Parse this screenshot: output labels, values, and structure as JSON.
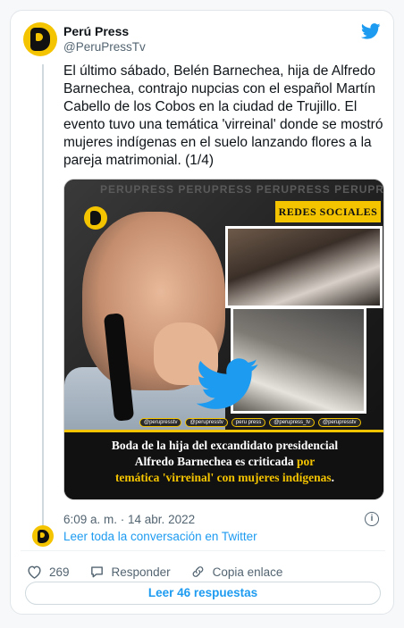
{
  "tweet": {
    "author_name": "Perú Press",
    "author_handle": "@PeruPressTv",
    "text": "El último sábado, Belén Barnechea, hija de Alfredo Barnechea, contrajo nupcias con el español Martín Cabello de los Cobos en la ciudad de Trujillo. El evento tuvo una temática 'virreinal' donde se mostró mujeres indígenas en el suelo lanzando flores a la pareja matrimonial. (1/4)",
    "timestamp": "6:09 a. m. · 14 abr. 2022"
  },
  "media": {
    "watermark": "PERUPRESS PERUPRESS PERUPRESS PERUPRESS PERUPRESS",
    "section_label": "REDES SOCIALES",
    "social_handles": [
      "@perupresstv",
      "@perupresstv",
      "peru press",
      "@perupress_tv",
      "@perupresstv"
    ],
    "caption_line1": "Boda de la hija del excandidato presidencial",
    "caption_line2_a": "Alfredo Barnechea es criticada ",
    "caption_line2_b": "por",
    "caption_line3_a": "temática 'virreinal' con mujeres indígenas",
    "caption_line3_b": "."
  },
  "conversation": {
    "link_text": "Leer toda la conversación en Twitter"
  },
  "actions": {
    "likes": "269",
    "reply_label": "Responder",
    "copy_label": "Copia enlace"
  },
  "read_button": "Leer 46 respuestas",
  "colors": {
    "twitter_blue": "#1d9bf0",
    "brand_yellow": "#f5c400",
    "like_icon": "heart-icon"
  }
}
